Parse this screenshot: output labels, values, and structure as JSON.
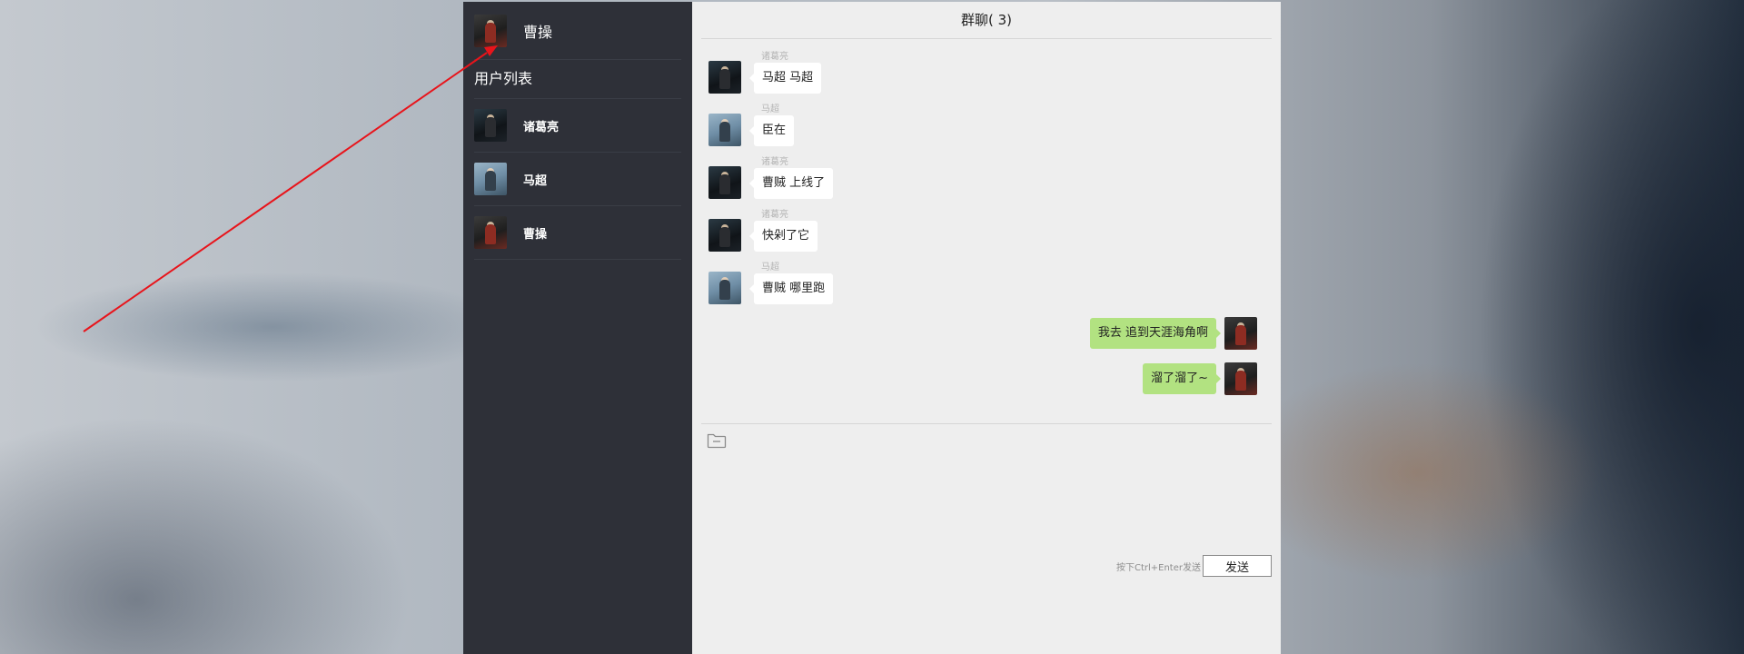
{
  "current_user": {
    "name": "曹操",
    "avatar": "caocao-avatar"
  },
  "sidebar": {
    "list_title": "用户列表",
    "users": [
      {
        "name": "诸葛亮",
        "avatar": "zhugeliang-avatar"
      },
      {
        "name": "马超",
        "avatar": "machao-avatar"
      },
      {
        "name": "曹操",
        "avatar": "caocao-avatar"
      }
    ]
  },
  "chat": {
    "title": "群聊( 3)",
    "messages": [
      {
        "sender": "诸葛亮",
        "text": "马超 马超",
        "self": false
      },
      {
        "sender": "马超",
        "text": "臣在",
        "self": false
      },
      {
        "sender": "诸葛亮",
        "text": "曹贼 上线了",
        "self": false
      },
      {
        "sender": "诸葛亮",
        "text": "快剁了它",
        "self": false
      },
      {
        "sender": "马超",
        "text": "曹贼 哪里跑",
        "self": false
      },
      {
        "sender": "曹操",
        "text": "我去 追到天涯海角啊",
        "self": true
      },
      {
        "sender": "曹操",
        "text": "溜了溜了~",
        "self": true
      }
    ],
    "toolbar": {
      "file_icon": "folder-icon"
    },
    "input": {
      "value": ""
    },
    "send_hint": "按下Ctrl+Enter发送",
    "send_label": "发送"
  },
  "colors": {
    "sidebar_bg": "#2e3038",
    "chat_bg": "#eeeeee",
    "self_bubble": "#b2e281",
    "other_bubble": "#ffffff",
    "annotation_arrow": "#e8141b"
  }
}
